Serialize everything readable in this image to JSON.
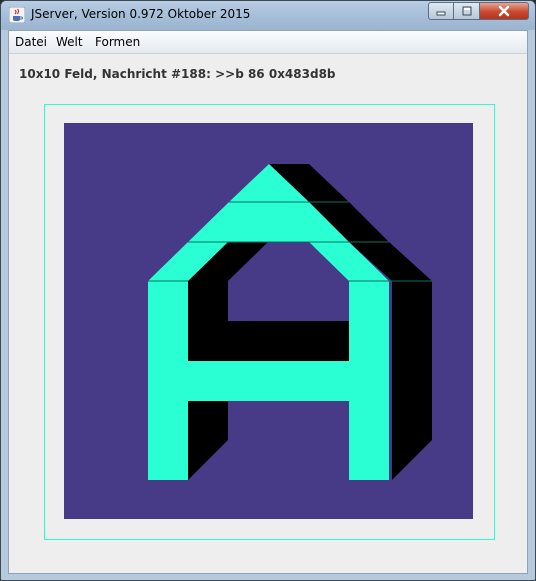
{
  "window": {
    "title": "JServer, Version 0.972 Oktober 2015",
    "app_icon": "java-cup-icon",
    "controls": {
      "minimize_icon": "minimize-icon",
      "maximize_icon": "maximize-icon",
      "close_icon": "close-icon"
    }
  },
  "menu": {
    "items": [
      {
        "label": "Datei"
      },
      {
        "label": "Welt"
      },
      {
        "label": "Formen"
      }
    ]
  },
  "status": {
    "text": "10x10 Feld, Nachricht #188: >>b 86 0x483d8b"
  },
  "board": {
    "rows": 10,
    "cols": 10,
    "background": "#473a86",
    "figure": "A",
    "figure_color": "#2affd4",
    "shadow_color": "#000000",
    "frame_color": "#2affd4"
  }
}
